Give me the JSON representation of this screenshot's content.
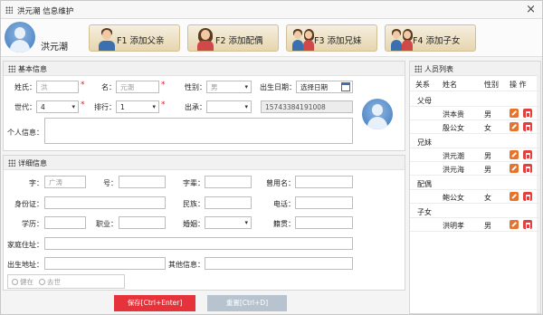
{
  "window": {
    "title": "洪元潮 信息维护"
  },
  "toolbar": {
    "user_name": "洪元潮",
    "buttons": [
      {
        "key": "F1",
        "label": "F1 添加父亲"
      },
      {
        "key": "F2",
        "label": "F2 添加配偶"
      },
      {
        "key": "F3",
        "label": "F3 添加兄妹"
      },
      {
        "key": "F4",
        "label": "F4 添加子女"
      }
    ]
  },
  "basic": {
    "title": "基本信息",
    "surname_label": "姓氏：",
    "surname_value": "洪",
    "name_label": "名：",
    "name_value": "元潮",
    "gender_label": "性别：",
    "gender_value": "男",
    "birth_label": "出生日期：",
    "birth_value": "选择日期",
    "generation_label": "世代：",
    "generation_value": "4",
    "rank_label": "排行：",
    "rank_value": "1",
    "origin_label": "出承：",
    "origin_value": "",
    "phone_value": "15743384191008",
    "personal_label": "个人信息："
  },
  "detail": {
    "title": "详细信息",
    "zi_label": "字：",
    "zi_value": "广涛",
    "hao_label": "号：",
    "ziyi_label": "字辈：",
    "former_name_label": "曾用名：",
    "idcard_label": "身份证：",
    "ethnic_label": "民族：",
    "phone_label": "电话：",
    "education_label": "学历：",
    "job_label": "职业：",
    "marriage_label": "婚姻：",
    "native_label": "籍贯：",
    "address_label": "家庭住址：",
    "birthplace_label": "出生地址：",
    "other_label": "其他信息：",
    "alive_label": "健在",
    "deceased_label": "去世"
  },
  "actions": {
    "save": "保存[Ctrl+Enter]",
    "reset": "重置[Ctrl+D]"
  },
  "people": {
    "title": "人员列表",
    "headers": {
      "relation": "关系",
      "name": "姓名",
      "gender": "性别",
      "ops": "操 作"
    },
    "groups": [
      {
        "name": "父母",
        "members": [
          {
            "name": "洪本贵",
            "gender": "男"
          },
          {
            "name": "殷公女",
            "gender": "女"
          }
        ]
      },
      {
        "name": "兄妹",
        "members": [
          {
            "name": "洪元潮",
            "gender": "男"
          },
          {
            "name": "洪元海",
            "gender": "男"
          }
        ]
      },
      {
        "name": "配偶",
        "members": [
          {
            "name": "鲍公女",
            "gender": "女"
          }
        ]
      },
      {
        "name": "子女",
        "members": [
          {
            "name": "洪明孝",
            "gender": "男"
          }
        ]
      }
    ]
  }
}
